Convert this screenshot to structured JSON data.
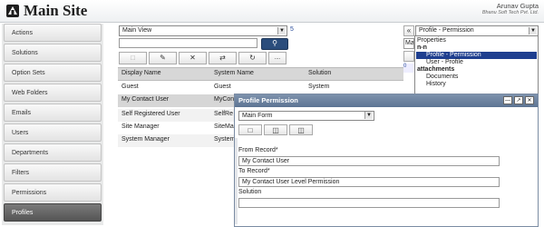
{
  "header": {
    "title": "Main Site",
    "user": "Arunav Gupta",
    "company": "Bhanu Soft Tech Pvt. Ltd."
  },
  "sidebar": {
    "items": [
      {
        "label": "Actions"
      },
      {
        "label": "Solutions"
      },
      {
        "label": "Option Sets"
      },
      {
        "label": "Web Folders"
      },
      {
        "label": "Emails"
      },
      {
        "label": "Users"
      },
      {
        "label": "Departments"
      },
      {
        "label": "Filters"
      },
      {
        "label": "Permissions"
      },
      {
        "label": "Profiles"
      }
    ],
    "active_index": 9
  },
  "view": {
    "selected": "Main View",
    "count": "5",
    "search_value": ""
  },
  "toolbar": {
    "more_label": "...."
  },
  "grid": {
    "columns": [
      "Display Name",
      "System Name",
      "Solution"
    ],
    "rows": [
      [
        "Guest",
        "Guest",
        "System"
      ],
      [
        "My Contact User",
        "MyCon",
        ""
      ],
      [
        "Self Registered User",
        "SelfRe",
        ""
      ],
      [
        "Site Manager",
        "SiteMa",
        ""
      ],
      [
        "System Manager",
        "System",
        ""
      ]
    ],
    "selected_row": 1
  },
  "profile_select": {
    "value": "Profile - Permission",
    "collapsed_prefix": "Ma"
  },
  "profile_list": [
    {
      "text": "Properties",
      "indent": 0,
      "bold": false
    },
    {
      "text": "n-n",
      "indent": 0,
      "bold": true
    },
    {
      "text": "Profile - Permission",
      "indent": 1,
      "bold": false,
      "selected": true
    },
    {
      "text": "User - Profile",
      "indent": 1,
      "bold": false
    },
    {
      "text": "attachments",
      "indent": 0,
      "bold": true
    },
    {
      "text": "Documents",
      "indent": 1,
      "bold": false
    },
    {
      "text": "History",
      "indent": 1,
      "bold": false
    }
  ],
  "popup": {
    "title": "Profile Permission",
    "form_select": "Main Form",
    "fields": [
      {
        "label": "From Record*",
        "value": "My Contact User"
      },
      {
        "label": "To Record*",
        "value": "My Contact User Level Permission"
      },
      {
        "label": "Solution",
        "value": ""
      }
    ]
  },
  "colors": {
    "accent": "#2b4d7c",
    "popup_title": "#6b819f",
    "selection": "#1f3f8f"
  }
}
